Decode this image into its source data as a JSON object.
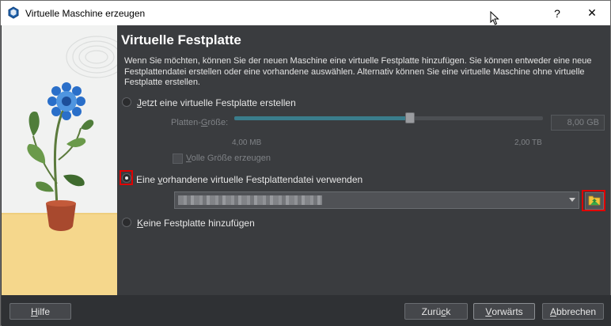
{
  "window": {
    "title": "Virtuelle Maschine erzeugen",
    "help_symbol": "?",
    "close_symbol": "✕"
  },
  "page": {
    "title": "Virtuelle Festplatte",
    "intro": "Wenn Sie möchten, können Sie der neuen Maschine eine virtuelle Festplatte hinzufügen. Sie können entweder eine neue Festplattendatei erstellen oder eine vorhandene auswählen. Alternativ können Sie eine virtuelle Maschine ohne virtuelle Festplatte erstellen."
  },
  "options": {
    "create_new": {
      "label": "Jetzt eine virtuelle Festplatte erstellen",
      "accesskey": "J",
      "rest": "etzt eine virtuelle Festplatte erstellen",
      "selected": false
    },
    "use_existing": {
      "label_before": "Eine ",
      "accesskey": "v",
      "label_after": "orhandene virtuelle Festplattendatei verwenden",
      "selected": true
    },
    "no_disk": {
      "accesskey": "K",
      "rest": "eine Festplatte hinzufügen",
      "selected": false
    }
  },
  "disk_size": {
    "label_before": "Platten-",
    "accesskey": "G",
    "label_after": "röße:",
    "value": "8,00 GB",
    "min_label": "4,00 MB",
    "max_label": "2,00 TB",
    "slider_fraction": 0.57
  },
  "full_size": {
    "accesskey": "V",
    "rest": "olle Größe erzeugen",
    "checked": false
  },
  "existing_file": {
    "value_obscured": true
  },
  "footer": {
    "help": {
      "accesskey": "H",
      "rest": "ilfe"
    },
    "back": {
      "before": "Zurü",
      "accesskey": "c",
      "after": "k"
    },
    "next": {
      "accesskey": "V",
      "rest": "orwärts"
    },
    "cancel": {
      "accesskey": "A",
      "rest": "bbrechen"
    }
  },
  "icons": {
    "app": "virtualbox-icon",
    "folder": "choose-file-folder-icon"
  },
  "colors": {
    "highlight": "#e00000",
    "slider_fill": "#3a7d8c"
  }
}
